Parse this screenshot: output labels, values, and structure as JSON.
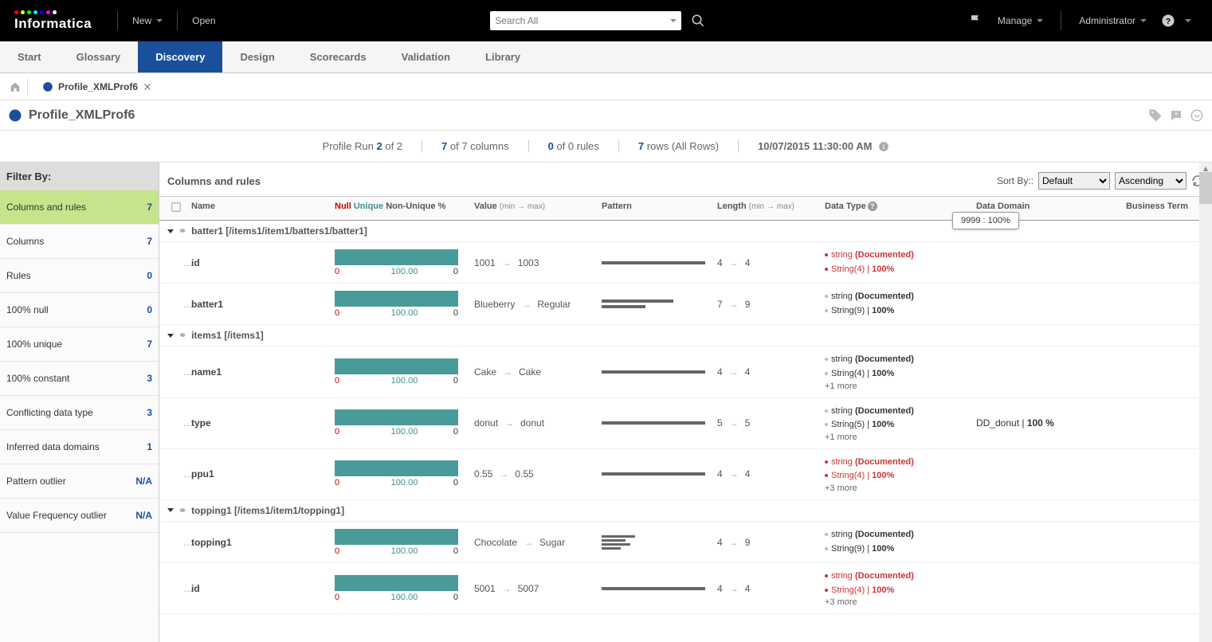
{
  "topbar": {
    "new_label": "New",
    "open_label": "Open",
    "search_placeholder": "Search All",
    "manage_label": "Manage",
    "admin_label": "Administrator"
  },
  "logo": {
    "text": "Informatica"
  },
  "navtabs": [
    "Start",
    "Glossary",
    "Discovery",
    "Design",
    "Scorecards",
    "Validation",
    "Library"
  ],
  "active_navtab": "Discovery",
  "breadcrumb": {
    "tab_label": "Profile_XMLProf6"
  },
  "page_title": "Profile_XMLProf6",
  "summary": {
    "run_prefix": "Profile Run ",
    "run_n": "2",
    "run_suffix": " of 2",
    "cols_n": "7",
    "cols_suffix": " of 7 columns",
    "rules_n": "0",
    "rules_suffix": " of 0 rules",
    "rows_n": "7",
    "rows_suffix": " rows (All Rows)",
    "timestamp": "10/07/2015 11:30:00 AM"
  },
  "sidebar": {
    "header": "Filter By:",
    "items": [
      {
        "label": "Columns and rules",
        "count": "7",
        "active": true
      },
      {
        "label": "Columns",
        "count": "7"
      },
      {
        "label": "Rules",
        "count": "0"
      },
      {
        "label": "100% null",
        "count": "0"
      },
      {
        "label": "100% unique",
        "count": "7"
      },
      {
        "label": "100% constant",
        "count": "3"
      },
      {
        "label": "Conflicting data type",
        "count": "3"
      },
      {
        "label": "Inferred data domains",
        "count": "1"
      },
      {
        "label": "Pattern outlier",
        "count": "N/A"
      },
      {
        "label": "Value Frequency outlier",
        "count": "N/A"
      }
    ]
  },
  "main": {
    "title": "Columns and rules",
    "sortby_label": "Sort By::",
    "sort1": "Default",
    "sort2": "Ascending"
  },
  "thead": {
    "name": "Name",
    "null": "Null",
    "unique": "Unique",
    "nonunique": "Non-Unique %",
    "value": "Value",
    "value_sub": "(min → max)",
    "pattern": "Pattern",
    "length": "Length",
    "length_sub": "(min → max)",
    "datatype": "Data Type",
    "domain": "Data Domain",
    "term": "Business Term"
  },
  "tooltip": "9999 : 100%",
  "groups": [
    {
      "label": "batter1 [/items1/item1/batters1/batter1]",
      "rows": [
        {
          "name": "id",
          "vmin": "1001",
          "vmax": "1003",
          "lmin": "4",
          "lmax": "4",
          "pattern": "single",
          "types": [
            {
              "t": "string (Documented)",
              "red": true
            },
            {
              "t": "String(4) | 100%",
              "red": true
            }
          ]
        },
        {
          "name": "batter1",
          "vmin": "Blueberry",
          "vmax": "Regular",
          "lmin": "7",
          "lmax": "9",
          "pattern": "two",
          "types": [
            {
              "t": "string (Documented)"
            },
            {
              "t": "String(9) | 100%"
            }
          ]
        }
      ]
    },
    {
      "label": "items1 [/items1]",
      "rows": [
        {
          "name": "name1",
          "vmin": "Cake",
          "vmax": "Cake",
          "lmin": "4",
          "lmax": "4",
          "pattern": "single",
          "types": [
            {
              "t": "string (Documented)"
            },
            {
              "t": "String(4) | 100%"
            }
          ],
          "more": "+1 more"
        },
        {
          "name": "type",
          "vmin": "donut",
          "vmax": "donut",
          "lmin": "5",
          "lmax": "5",
          "pattern": "single",
          "types": [
            {
              "t": "string (Documented)"
            },
            {
              "t": "String(5) | 100%"
            }
          ],
          "more": "+1 more",
          "domain": "DD_donut | 100 %"
        },
        {
          "name": "ppu1",
          "vmin": "0.55",
          "vmax": "0.55",
          "lmin": "4",
          "lmax": "4",
          "pattern": "single",
          "types": [
            {
              "t": "string (Documented)",
              "red": true
            },
            {
              "t": "String(4) | 100%",
              "red": true
            }
          ],
          "more": "+3 more"
        }
      ]
    },
    {
      "label": "topping1 [/items1/item1/topping1]",
      "rows": [
        {
          "name": "topping1",
          "vmin": "Chocolate",
          "vmax": "Sugar",
          "lmin": "4",
          "lmax": "9",
          "pattern": "multi",
          "types": [
            {
              "t": "string (Documented)"
            },
            {
              "t": "String(9) | 100%"
            }
          ]
        },
        {
          "name": "id",
          "vmin": "5001",
          "vmax": "5007",
          "lmin": "4",
          "lmax": "4",
          "pattern": "single",
          "types": [
            {
              "t": "string (Documented)",
              "red": true
            },
            {
              "t": "String(4) | 100%",
              "red": true
            }
          ],
          "more": "+3 more"
        }
      ]
    }
  ],
  "bar_labels": {
    "zero": "0",
    "hundred": "100.00",
    "zero2": "0"
  }
}
